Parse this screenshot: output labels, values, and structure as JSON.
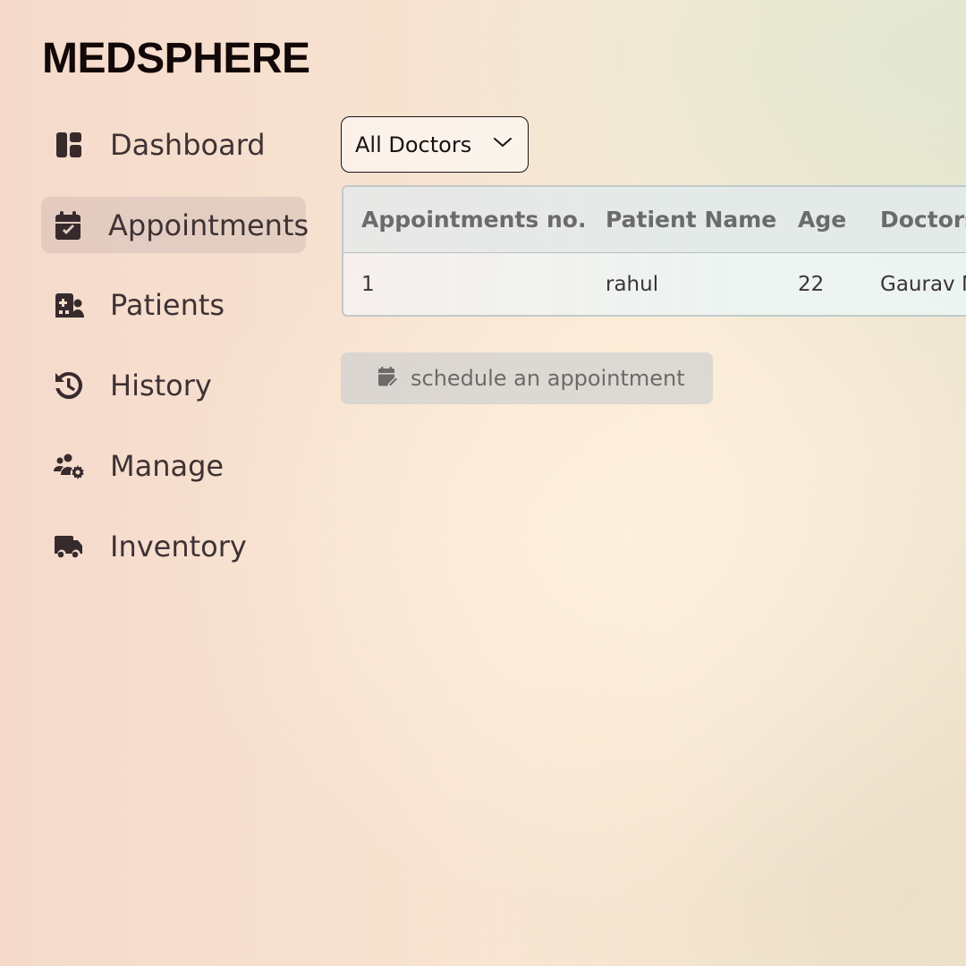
{
  "app": {
    "title": "MEDSPHERE"
  },
  "sidebar": {
    "items": [
      {
        "label": "Dashboard",
        "icon": "dashboard-icon",
        "active": false
      },
      {
        "label": "Appointments",
        "icon": "calendar-check-icon",
        "active": true
      },
      {
        "label": "Patients",
        "icon": "hospital-user-icon",
        "active": false
      },
      {
        "label": "History",
        "icon": "history-icon",
        "active": false
      },
      {
        "label": "Manage",
        "icon": "users-gear-icon",
        "active": false
      },
      {
        "label": "Inventory",
        "icon": "truck-icon",
        "active": false
      }
    ]
  },
  "filter": {
    "selected": "All Doctors",
    "icon": "chevron-down-icon"
  },
  "table": {
    "headers": [
      "Appointments no.",
      "Patient Name",
      "Age",
      "Doctors"
    ],
    "rows": [
      [
        "1",
        "rahul",
        "22",
        "Gaurav M"
      ]
    ]
  },
  "actions": {
    "schedule_label": "schedule an appointment",
    "schedule_icon": "calendar-edit-icon"
  },
  "colors": {
    "logo": "#130808",
    "active_nav_bg": "#d9c6c4",
    "icon": "#362a2c",
    "header_text": "#6b6b6b"
  }
}
